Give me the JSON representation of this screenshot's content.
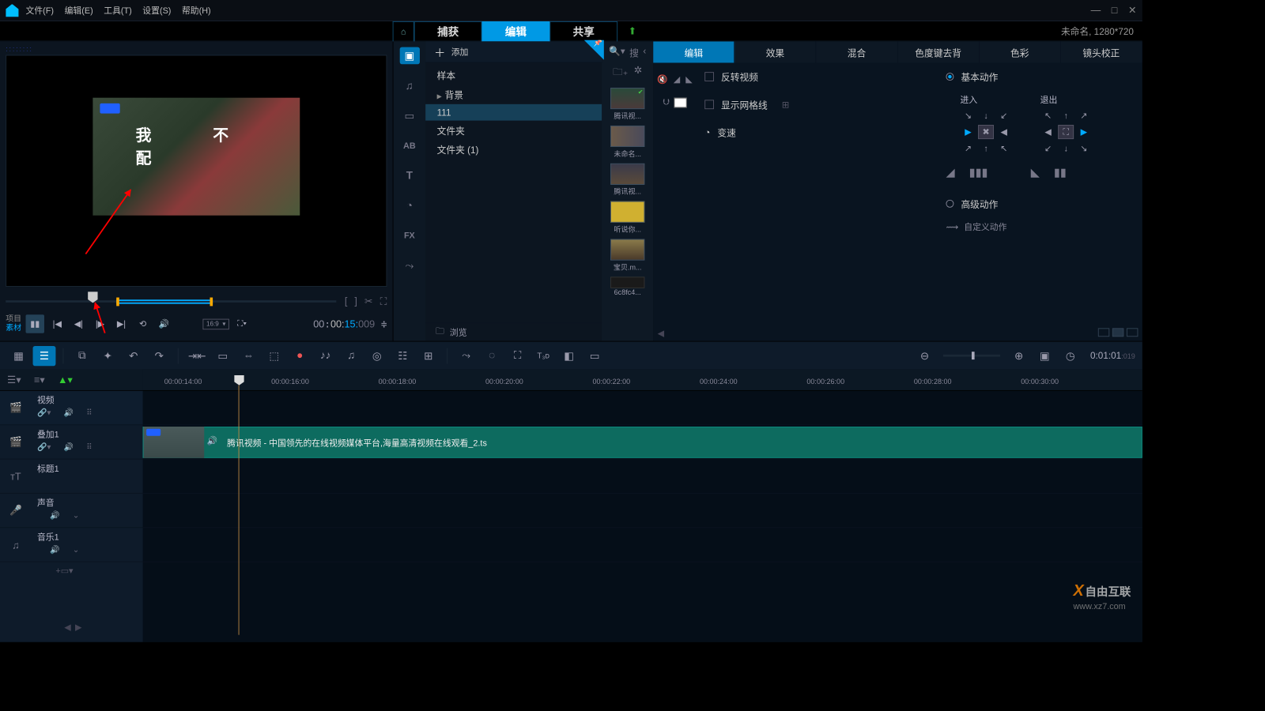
{
  "menu": {
    "file": "文件(F)",
    "edit": "编辑(E)",
    "tools": "工具(T)",
    "settings": "设置(S)",
    "help": "帮助(H)"
  },
  "project_label": "未命名, 1280*720",
  "top_tabs": {
    "capture": "捕获",
    "edit": "编辑",
    "share": "共享"
  },
  "preview": {
    "overlay_chars": "我 不 配",
    "left_lbl_project": "项目",
    "left_lbl_material": "素材",
    "ratio": "16:9",
    "time_h": "00",
    "time_m": "00:",
    "time_s": "15:",
    "time_f": "009"
  },
  "library": {
    "add": "添加",
    "items": {
      "sample": "样本",
      "background": "背景",
      "folder111": "111",
      "folder": "文件夹",
      "folder_1": "文件夹 (1)"
    },
    "browse": "浏览",
    "search_ph": "搜",
    "thumbs": [
      "腾讯视...",
      "未命名...",
      "腾讯视...",
      "听说你...",
      "宝贝.m...",
      "6c8fc4..."
    ]
  },
  "options": {
    "tabs": [
      "编辑",
      "效果",
      "混合",
      "色度键去背",
      "色彩",
      "镜头校正"
    ],
    "flip_video": "反转视频",
    "show_grid": "显示网格线",
    "speed": "变速",
    "basic": "基本动作",
    "enter": "进入",
    "exit": "退出",
    "advanced": "高级动作",
    "custom": "自定义动作"
  },
  "toolbar": {
    "time": "0:01:01",
    "frames": ":019"
  },
  "timeline": {
    "ruler": [
      "00:00:14:00",
      "00:00:16:00",
      "00:00:18:00",
      "00:00:20:00",
      "00:00:22:00",
      "00:00:24:00",
      "00:00:26:00",
      "00:00:28:00",
      "00:00:30:00"
    ],
    "tracks": {
      "video": "视频",
      "overlay": "叠加1",
      "title": "标题1",
      "voice": "声音",
      "music": "音乐1"
    },
    "clip_text": "腾讯视频 - 中国领先的在线视频媒体平台,海量高清视频在线观看_2.ts"
  },
  "watermark": {
    "brand": "自由互联",
    "url": "www.xz7.com"
  }
}
